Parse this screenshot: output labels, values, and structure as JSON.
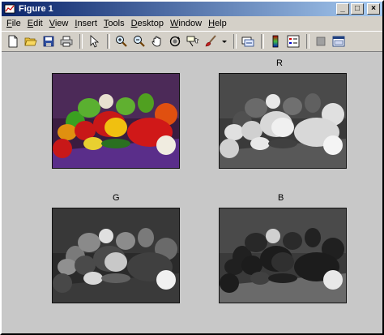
{
  "window": {
    "title": "Figure 1"
  },
  "controls": {
    "minimize": "_",
    "maximize": "□",
    "close": "×"
  },
  "menu": [
    {
      "pre": "",
      "u": "F",
      "post": "ile"
    },
    {
      "pre": "",
      "u": "E",
      "post": "dit"
    },
    {
      "pre": "",
      "u": "V",
      "post": "iew"
    },
    {
      "pre": "",
      "u": "I",
      "post": "nsert"
    },
    {
      "pre": "",
      "u": "T",
      "post": "ools"
    },
    {
      "pre": "",
      "u": "D",
      "post": "esktop"
    },
    {
      "pre": "",
      "u": "W",
      "post": "indow"
    },
    {
      "pre": "",
      "u": "H",
      "post": "elp"
    }
  ],
  "toolbar_icons": [
    "new-figure-icon",
    "open-file-icon",
    "save-icon",
    "print-icon",
    "select-arrow-icon",
    "zoom-in-icon",
    "zoom-out-icon",
    "pan-icon",
    "rotate-3d-icon",
    "data-cursor-icon",
    "brush-icon",
    "brush-dropdown-icon",
    "link-plot-icon",
    "colorbar-icon",
    "legend-icon",
    "hide-plot-tools-icon",
    "show-plot-tools-icon"
  ],
  "subplots": {
    "rgb": {
      "title": ""
    },
    "r": {
      "title": "R"
    },
    "g": {
      "title": "G"
    },
    "b": {
      "title": "B"
    }
  }
}
